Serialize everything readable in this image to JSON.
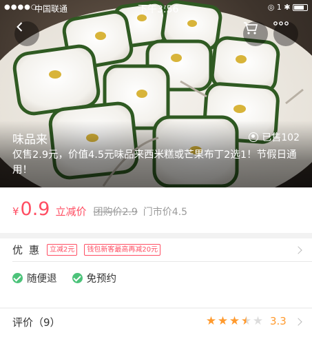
{
  "status_bar": {
    "signal": "●●●●○",
    "carrier": "中国联通",
    "time": "下午3:56",
    "right_status": "◎ 1 ✱"
  },
  "icons": {
    "back": "back-arrow-icon",
    "cart": "cart-icon",
    "more": "more-dots-icon",
    "sold": "user-icon",
    "check": "check-circle-icon",
    "chevron": "chevron-right-icon"
  },
  "colors": {
    "accent": "#ff4d62",
    "star": "#ff9a2e",
    "check": "#4cc37a"
  },
  "deal": {
    "merchant": "味品来",
    "sold": "已售102",
    "description": "仅售2.9元，价值4.5元味品来西米糕或芒果布丁2选1！节假日通用！"
  },
  "price": {
    "currency": "¥",
    "current": "0.9",
    "discount_label": "立减价",
    "group_price": "团购价2.9",
    "store_price": "门市价4.5"
  },
  "promotions": {
    "label": "优惠",
    "tags": [
      "立减2元",
      "钱包新客最高再减20元"
    ]
  },
  "guarantees": [
    {
      "label": "随便退"
    },
    {
      "label": "免预约"
    }
  ],
  "reviews": {
    "label": "评价（9）",
    "rating": "3.3",
    "stars_value": 3.3,
    "stars_max": 5
  }
}
